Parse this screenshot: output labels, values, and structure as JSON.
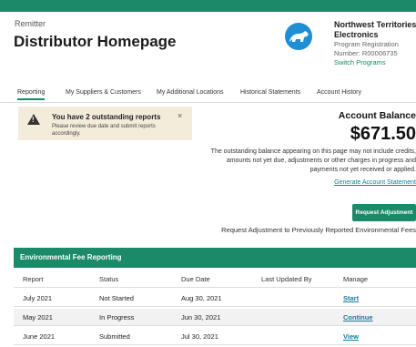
{
  "header": {
    "remitter_label": "Remitter",
    "title": "Distributor Homepage",
    "company_name": "Northwest Territories Electronics",
    "program_registration": "Program Registration",
    "registration_number": "Number: R00006735",
    "switch_programs": "Switch Programs",
    "logo_icon": "polar-bear-logo",
    "brand_color": "#1a8a68"
  },
  "tabs": [
    {
      "label": "Reporting",
      "active": true
    },
    {
      "label": "My Suppliers & Customers"
    },
    {
      "label": "My Additional Locations"
    },
    {
      "label": "Historical Statements"
    },
    {
      "label": "Account History"
    }
  ],
  "alert": {
    "icon": "warning-icon",
    "heading": "You have 2 outstanding reports",
    "body": "Please review due date and submit reports accordingly.",
    "close": "×"
  },
  "account": {
    "label": "Account Balance",
    "amount": "$671.50",
    "description": "The outstanding balance appearing on this page may not include credits, amounts not yet due, adjustments or other charges in progress and payments not yet received or applied.",
    "statement_link": "Generate Account Statement",
    "request_button": "Request Adjustment",
    "request_text": "Request Adjustment to Previously Reported Environmental Fees"
  },
  "reporting": {
    "title": "Environmental Fee Reporting",
    "columns": [
      "Report",
      "Status",
      "Due Date",
      "Last Updated By",
      "Manage"
    ],
    "rows": [
      {
        "report": "July 2021",
        "status": "Not Started",
        "due": "Aug 30, 2021",
        "updated_by": "",
        "manage": "Start"
      },
      {
        "report": "May 2021",
        "status": "In Progress",
        "due": "Jun 30, 2021",
        "updated_by": "",
        "manage": "Continue"
      },
      {
        "report": "June 2021",
        "status": "Submitted",
        "due": "Jul 30, 2021",
        "updated_by": "",
        "manage": "View"
      }
    ]
  }
}
